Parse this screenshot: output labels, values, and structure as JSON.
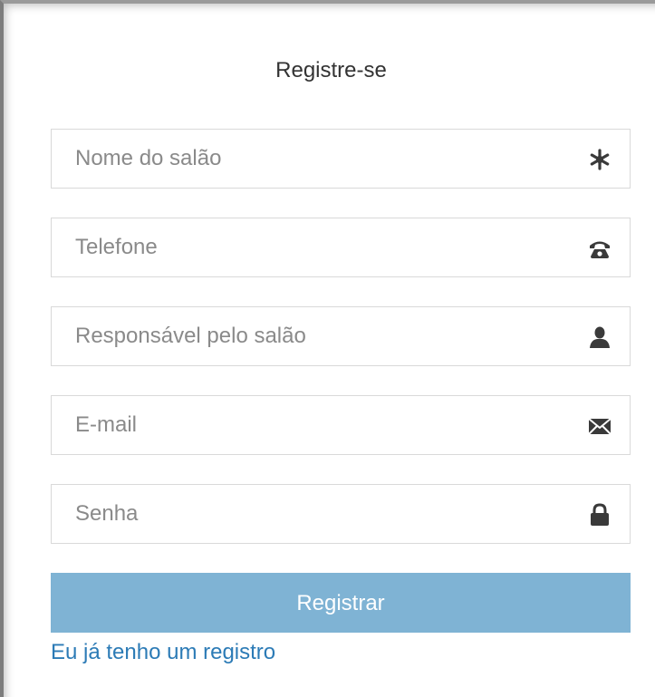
{
  "form": {
    "title": "Registre-se",
    "fields": [
      {
        "placeholder": "Nome do salão",
        "icon": "asterisk-icon"
      },
      {
        "placeholder": "Telefone",
        "icon": "phone-icon"
      },
      {
        "placeholder": "Responsável pelo salão",
        "icon": "user-icon"
      },
      {
        "placeholder": "E-mail",
        "icon": "envelope-icon"
      },
      {
        "placeholder": "Senha",
        "icon": "lock-icon"
      }
    ],
    "submit_label": "Registrar",
    "login_link": "Eu já tenho um registro"
  },
  "colors": {
    "button": "#7fb3d4",
    "link": "#2c7bb6",
    "border": "#d9d9d9",
    "icon": "#3a3a3a"
  }
}
